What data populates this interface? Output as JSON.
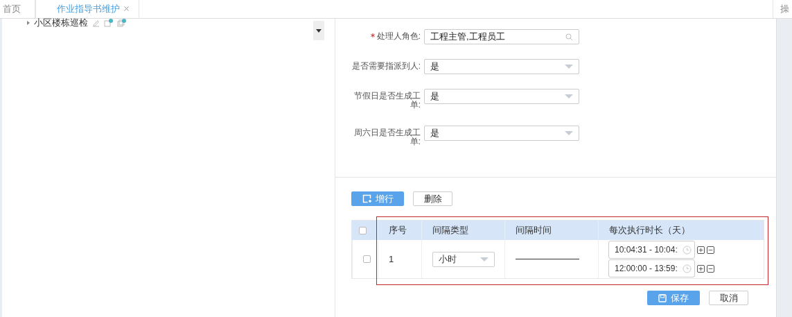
{
  "tabs": [
    {
      "label": "首页",
      "selected": false,
      "closable": false
    },
    {
      "label": "作业指导书维护",
      "selected": true,
      "closable": true
    },
    {
      "label": "操",
      "selected": false,
      "closable": false
    }
  ],
  "tree": {
    "items": [
      {
        "label": "小区楼栋巡检",
        "expanded": false
      }
    ]
  },
  "form": {
    "fields": [
      {
        "kind": "search",
        "label": "处理人角色:",
        "required": true,
        "value": "工程主管,工程员工"
      },
      {
        "kind": "select",
        "label": "是否需要指派到人:",
        "required": false,
        "value": "是"
      },
      {
        "kind": "select",
        "label": "节假日是否生成工单:",
        "required": false,
        "value": "是"
      },
      {
        "kind": "select",
        "label": "周六日是否生成工单:",
        "required": false,
        "value": "是"
      }
    ]
  },
  "toolbar": {
    "add": "增行",
    "delete": "删除"
  },
  "table": {
    "columns": [
      "序号",
      "间隔类型",
      "间隔时间",
      "每次执行时长（天）"
    ],
    "header_checked": false,
    "rows": [
      {
        "checked": false,
        "index": "1",
        "interval_type": "小时",
        "times": [
          "10:04:31 - 10:04:",
          "12:00:00 - 13:59:"
        ]
      }
    ]
  },
  "actions": {
    "save": "保存",
    "cancel": "取消"
  }
}
